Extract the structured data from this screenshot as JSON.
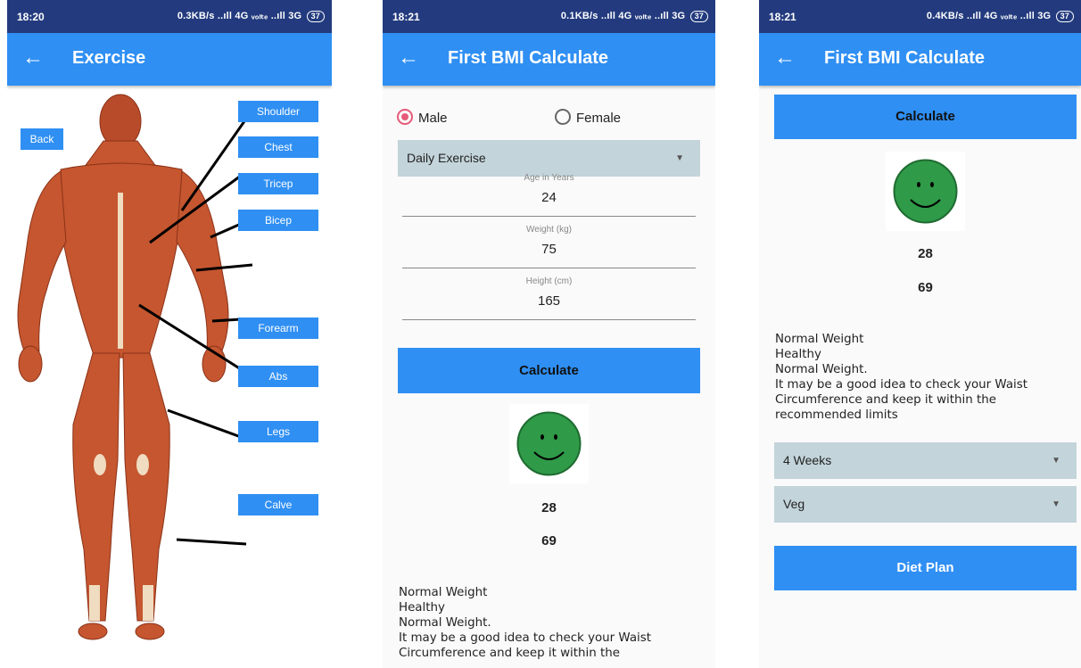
{
  "screen1": {
    "status": {
      "time": "18:20",
      "network": "0.3KB/s ..ıll 4G ᵥₒₗₜₑ ..ıll 3G",
      "battery": "37"
    },
    "title": "Exercise",
    "back_button": "Back",
    "muscles": [
      "Shoulder",
      "Chest",
      "Tricep",
      "Bicep",
      "Forearm",
      "Abs",
      "Legs",
      "Calve"
    ],
    "colors": {
      "appbar": "#2f8ff3",
      "statusbar": "#233b7e",
      "muscle": "#c5562f"
    }
  },
  "screen2": {
    "status": {
      "time": "18:21",
      "network": "0.1KB/s ..ıll 4G ᵥₒₗₜₑ ..ıll 3G",
      "battery": "37"
    },
    "title": "First BMI Calculate",
    "gender": {
      "male": "Male",
      "female": "Female",
      "selected": "Male"
    },
    "activity_dropdown": "Daily Exercise",
    "age": {
      "hint": "Age in Years",
      "value": "24"
    },
    "weight": {
      "hint": "Weight (kg)",
      "value": "75"
    },
    "height": {
      "hint": "Height (cm)",
      "value": "165"
    },
    "calculate_button": "Calculate",
    "bmi": "28",
    "ideal": "69",
    "message": [
      "Normal Weight",
      "Healthy",
      "Normal Weight.",
      " It may be a good idea to check your Waist",
      "Circumference and keep it within the"
    ]
  },
  "screen3": {
    "status": {
      "time": "18:21",
      "network": "0.4KB/s ..ıll 4G ᵥₒₗₜₑ ..ıll 3G",
      "battery": "37"
    },
    "title": "First BMI Calculate",
    "calculate_button": "Calculate",
    "bmi": "28",
    "ideal": "69",
    "message": [
      "Normal Weight",
      "Healthy",
      "Normal Weight.",
      " It may be a good idea to check your Waist",
      "Circumference and keep it within the",
      "recommended limits"
    ],
    "weeks_dropdown": "4 Weeks",
    "diet_dropdown": "Veg",
    "diet_button": "Diet Plan"
  }
}
